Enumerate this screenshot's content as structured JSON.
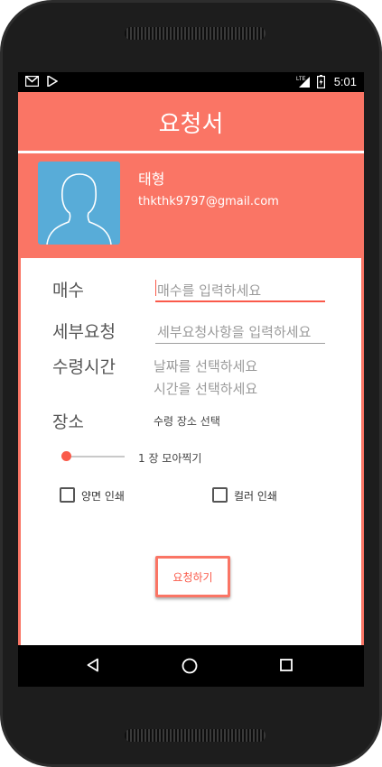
{
  "status_bar": {
    "time": "5:01",
    "network": "LTE",
    "left_icons": [
      "gmail-icon",
      "play-store-icon"
    ],
    "right_icons": [
      "signal-icon",
      "battery-icon"
    ]
  },
  "app_bar": {
    "title": "요청서"
  },
  "profile": {
    "name": "태형",
    "email": "thkthk9797@gmail.com"
  },
  "form": {
    "count_label": "매수",
    "count_placeholder": "매수를 입력하세요",
    "detail_label": "세부요청",
    "detail_placeholder": "세부요청사항을 입력하세요",
    "time_label": "수령시간",
    "date_prompt": "날짜를 선택하세요",
    "time_prompt": "시간을 선택하세요",
    "place_label": "장소",
    "place_prompt": "수령 장소 선택",
    "slider_text": "1 장 모아찍기",
    "slider_value": 1,
    "duplex_label": "양면 인쇄",
    "duplex_checked": false,
    "color_label": "컬러 인쇄",
    "color_checked": false,
    "submit_label": "요청하기"
  },
  "colors": {
    "accent": "#fa7565",
    "accent_dark": "#fa5a4a",
    "avatar_bg": "#58acd8"
  }
}
